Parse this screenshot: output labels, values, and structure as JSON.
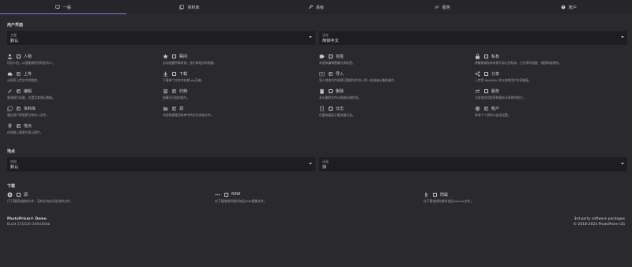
{
  "tabs": [
    {
      "label": "一般",
      "icon": "monitor-icon"
    },
    {
      "label": "资料库",
      "icon": "library-icon"
    },
    {
      "label": "高级",
      "icon": "wrench-icon"
    },
    {
      "label": "服务",
      "icon": "sync-icon"
    },
    {
      "label": "账户",
      "icon": "account-icon"
    }
  ],
  "ui_section": {
    "title": "用户界面",
    "theme": {
      "label": "主题",
      "value": "默认"
    },
    "language": {
      "label": "语言",
      "value": "简体中文"
    }
  },
  "options": [
    {
      "icon": "person-icon",
      "label": "人物",
      "desc": "识别人脸，以便能够找到特定的人。",
      "checked": false
    },
    {
      "icon": "star-icon",
      "label": "瞬间",
      "desc": "自动创建特殊时刻、旅行和地点的相册。",
      "checked": false
    },
    {
      "icon": "label-icon",
      "label": "标签",
      "desc": "浏览和编辑图像分类标签。",
      "checked": false
    },
    {
      "icon": "lock-icon",
      "label": "私有",
      "desc": "将敏感或私有的照片标记为私有，已共享的相册、视图和选择外。",
      "checked": false
    },
    {
      "icon": "cloud-upload-icon",
      "label": "上传",
      "desc": "从网页上传文件到相库。",
      "checked": true
    },
    {
      "icon": "download-icon",
      "label": "下载",
      "desc": "下载单个文件并存储.zip压缩。",
      "checked": false
    },
    {
      "icon": "import-icon",
      "label": "导入",
      "desc": "导入其他文件或把已整理文件导入到一起或者从服务器中.",
      "checked": true
    },
    {
      "icon": "share-icon",
      "label": "分享",
      "desc": "上传到 WebDAV 并与其他用户共享链接。",
      "checked": false
    },
    {
      "icon": "pencil-icon",
      "label": "编辑",
      "desc": "更改照片标题、位置及其他元数据。",
      "checked": true
    },
    {
      "icon": "archive-icon",
      "label": "归档",
      "desc": "隐藏已归档的照片。",
      "checked": true
    },
    {
      "icon": "trash-icon",
      "label": "删除",
      "desc": "永久删除文件以释放存储空间。",
      "checked": false
    },
    {
      "icon": "services-icon",
      "label": "服务",
      "desc": "与其他应用程序和服务分享你的照片。",
      "checked": false
    },
    {
      "icon": "library-icon",
      "label": "资料库",
      "desc": "通过用户界面索引和导入文件。",
      "checked": true
    },
    {
      "icon": "folder-icon",
      "label": "源",
      "desc": "浏览和管理资料库中的文件夹和文件。",
      "checked": true
    },
    {
      "icon": "log-icon",
      "label": "日志",
      "desc": "在服务器显示服务器日志。",
      "checked": false
    },
    {
      "icon": "shield-icon",
      "label": "账户",
      "desc": "修改个人资料与安全设置。",
      "checked": true
    },
    {
      "icon": "place-icon",
      "label": "地点",
      "desc": "在地图上搜索并显示照片。",
      "checked": true
    }
  ],
  "places_section": {
    "title": "地点",
    "map": {
      "label": "地图",
      "value": "默认"
    },
    "animation": {
      "label": "动画",
      "value": "快"
    }
  },
  "download_section": {
    "title": "下载",
    "options": [
      {
        "icon": "plus-circle-icon",
        "label": "源",
        "desc": "只下载原始媒体文件，没有任何自动生成的文件。",
        "checked": false
      },
      {
        "icon": "raw-icon",
        "label": "RAW",
        "desc": "在下载堆栈时候时包括RAW图像文件。",
        "checked": false
      },
      {
        "icon": "paperclip-icon",
        "label": "附属",
        "desc": "在下载堆栈时候时包括sidecar文件。",
        "checked": false
      }
    ]
  },
  "footer": {
    "name": "PhotoPrism® Demo",
    "build": "Build 231029-3d6d30bb",
    "third_party": "3rd-party software packages",
    "copyright": "© 2018-2023 PhotoPrism UG"
  }
}
